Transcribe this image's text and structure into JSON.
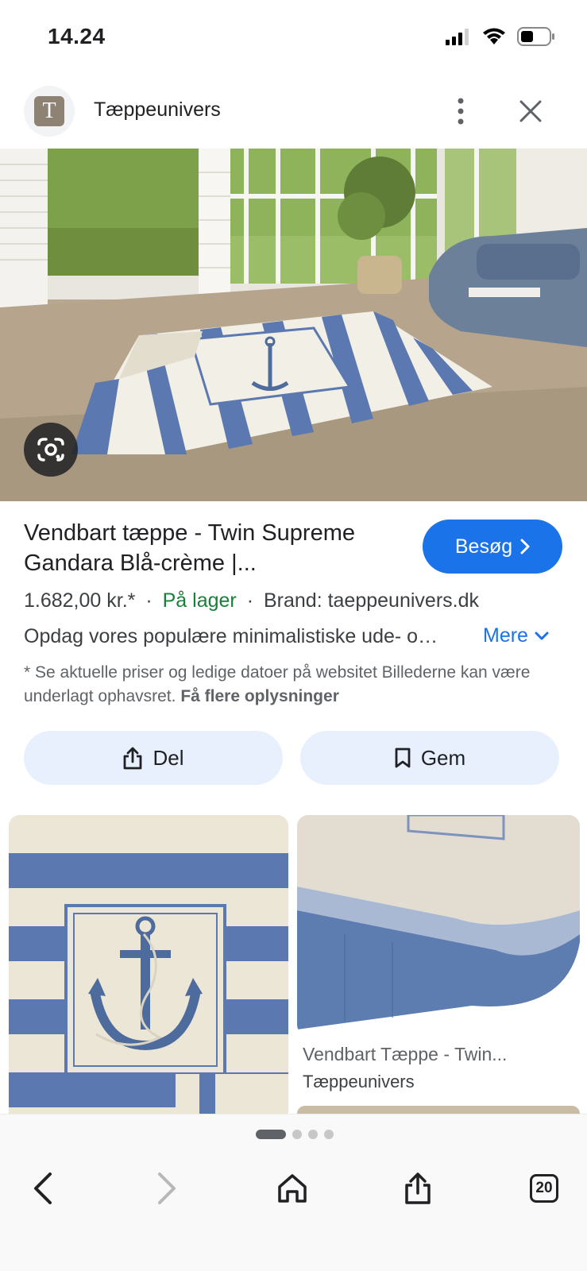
{
  "status_bar": {
    "time": "14.24",
    "icons": [
      "cellular-signal-icon",
      "wifi-icon",
      "battery-icon"
    ]
  },
  "header": {
    "site_initial": "T",
    "site_name": "Tæppeunivers",
    "more_icon": "vertical-dots-icon",
    "close_icon": "close-icon"
  },
  "hero": {
    "image_description_icon": "photo",
    "lens_icon": "google-lens-icon"
  },
  "product": {
    "title": "Vendbart tæppe - Twin Supreme Gandara Blå-crème |...",
    "visit_label": "Besøg",
    "price": "1.682,00 kr.*",
    "stock": "På lager",
    "brand": "Brand: taeppeunivers.dk",
    "separator": "·",
    "description": "Opdag vores populære minimalistiske ude- o…",
    "more_label": "Mere",
    "disclaimer_text": "* Se aktuelle priser og ledige datoer på websitet Billederne kan være underlagt ophavsret.",
    "disclaimer_link": "Få flere oplysninger"
  },
  "actions": {
    "share_label": "Del",
    "save_label": "Gem"
  },
  "related": {
    "item2_title": "Vendbart Tæppe - Twin...",
    "item2_source": "Tæppeunivers"
  },
  "pagination": {
    "pages": 4,
    "active_index": 0
  },
  "toolbar": {
    "back_icon": "chevron-left-icon",
    "forward_icon": "chevron-right-icon",
    "home_icon": "home-icon",
    "share_icon": "share-icon",
    "tabs_count": "20"
  },
  "colors": {
    "accent": "#1a73e8",
    "stock_green": "#188038",
    "button_tint": "#e8f0fe"
  }
}
